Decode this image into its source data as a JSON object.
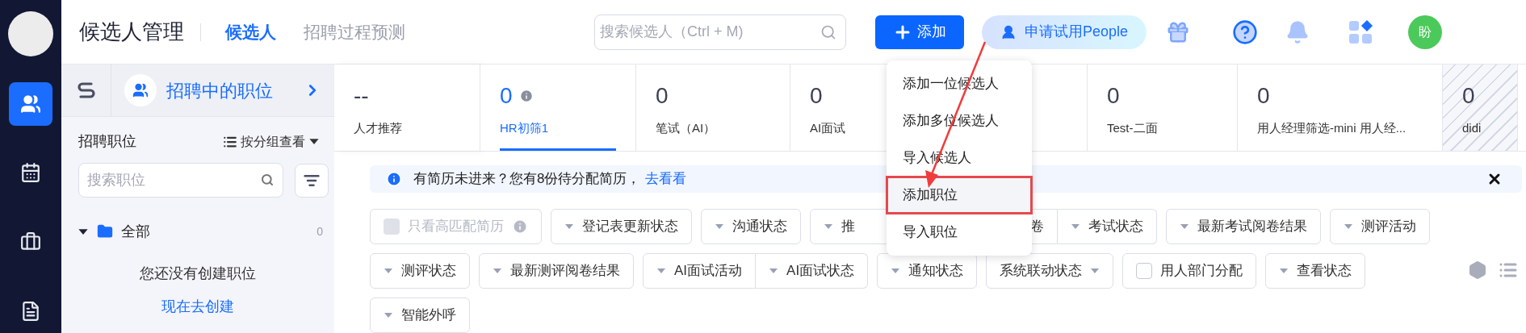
{
  "nav_items": [
    {
      "kind": "avatar",
      "selected": false
    },
    {
      "kind": "people",
      "selected": true
    },
    {
      "kind": "calendar",
      "selected": false
    },
    {
      "kind": "briefcase",
      "selected": false
    },
    {
      "kind": "document",
      "selected": false
    }
  ],
  "header": {
    "title": "候选人管理",
    "tabs": [
      {
        "label": "候选人",
        "selected": true
      },
      {
        "label": "招聘过程预测",
        "selected": false
      }
    ],
    "search": {
      "placeholder": "搜索候选人（Ctrl + M)"
    },
    "add_button": "添加",
    "trial_button": "申请试用People",
    "avatar": "盼"
  },
  "add_menu": {
    "items": [
      {
        "label": "添加一位候选人",
        "selected": false
      },
      {
        "label": "添加多位候选人",
        "selected": false
      },
      {
        "label": "导入候选人",
        "selected": false
      },
      {
        "label": "添加职位",
        "selected": true
      },
      {
        "label": "导入职位",
        "selected": false
      }
    ]
  },
  "positions_panel": {
    "title": "招聘中的职位",
    "section_label": "招聘职位",
    "group_view": "按分组查看",
    "search": {
      "placeholder": "搜索职位"
    },
    "tree": [
      {
        "label": "全部",
        "count": "0",
        "expanded": true
      }
    ],
    "empty_text": "您还没有创建职位",
    "create_link": "现在去创建"
  },
  "stages": [
    {
      "kind": "stage",
      "count": "--",
      "label": "人才推荐",
      "selected": false,
      "info": false,
      "disabled": false
    },
    {
      "kind": "stage",
      "count": "0",
      "label": "HR初筛1",
      "selected": true,
      "info": true,
      "disabled": false
    },
    {
      "kind": "stage",
      "count": "0",
      "label": "笔试（AI）",
      "selected": false,
      "info": false,
      "disabled": false
    },
    {
      "kind": "stage",
      "count": "0",
      "label": "AI面试",
      "selected": false,
      "info": false,
      "disabled": false
    },
    {
      "kind": "covered"
    },
    {
      "kind": "stage",
      "count": "0",
      "label": "Test-二面",
      "selected": false,
      "info": false,
      "disabled": false
    },
    {
      "kind": "stage",
      "count": "0",
      "label": "用人经理筛选-mini 用人经...",
      "selected": false,
      "info": false,
      "disabled": false
    },
    {
      "kind": "stage",
      "count": "0",
      "label": "didi",
      "selected": false,
      "info": false,
      "disabled": true
    }
  ],
  "notice": {
    "text": "有简历未进来？您有8份待分配简历，",
    "link": "去看看"
  },
  "filter_rows": [
    [
      {
        "kind": "checkbox",
        "label": "只看高匹配简历",
        "checked": false,
        "disabled": true,
        "info": true
      },
      {
        "kind": "dropdown",
        "label": "登记表更新状态"
      },
      {
        "kind": "dropdown",
        "label": "沟通状态"
      },
      {
        "kind": "covered",
        "label": "推"
      },
      {
        "kind": "group",
        "parts": [
          {
            "label": "卷",
            "caret": false
          },
          {
            "label": "考试状态",
            "caret": true
          }
        ]
      },
      {
        "kind": "dropdown",
        "label": "最新考试阅卷结果"
      },
      {
        "kind": "dropdown",
        "label": "测评活动"
      }
    ],
    [
      {
        "kind": "dropdown",
        "label": "测评状态"
      },
      {
        "kind": "dropdown",
        "label": "最新测评阅卷结果"
      },
      {
        "kind": "group",
        "parts": [
          {
            "label": "AI面试活动",
            "caret": true
          },
          {
            "label": "AI面试状态",
            "caret": true
          }
        ]
      },
      {
        "kind": "dropdown",
        "label": "通知状态"
      },
      {
        "kind": "trailing",
        "label": "系统联动状态"
      },
      {
        "kind": "checkbox",
        "label": "用人部门分配",
        "checked": false,
        "disabled": false,
        "info": false
      },
      {
        "kind": "dropdown",
        "label": "查看状态"
      }
    ],
    [
      {
        "kind": "dropdown",
        "label": "智能外呼"
      }
    ]
  ]
}
